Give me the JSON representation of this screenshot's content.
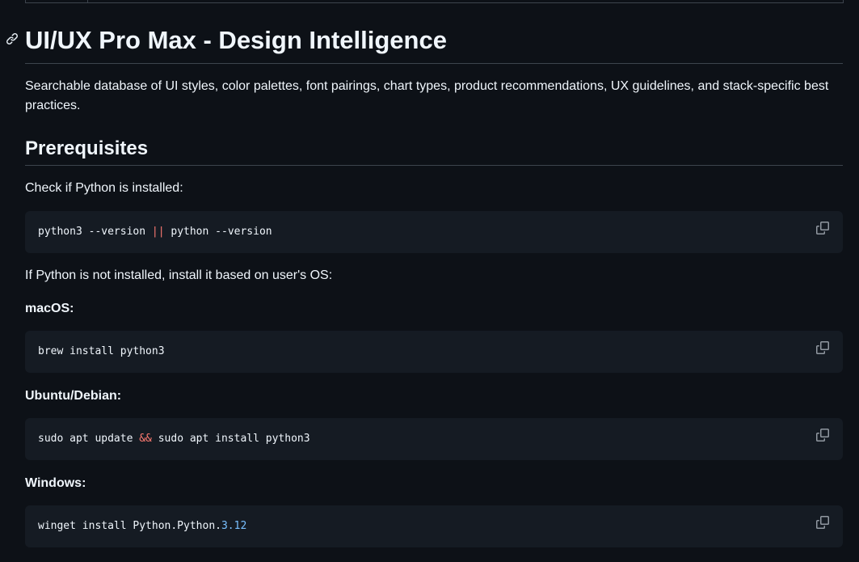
{
  "heading": {
    "title": "UI/UX Pro Max - Design Intelligence",
    "description": "Searchable database of UI styles, color palettes, font pairings, chart types, product recommendations, UX guidelines, and stack-specific best practices."
  },
  "prerequisites": {
    "title": "Prerequisites",
    "check_text": "Check if Python is installed:",
    "check_code": {
      "part1": "python3 --version ",
      "op": "||",
      "part2": " python --version"
    },
    "install_text": "If Python is not installed, install it based on user's OS:"
  },
  "platforms": {
    "macos": {
      "label": "macOS:",
      "code": "brew install python3"
    },
    "ubuntu": {
      "label": "Ubuntu/Debian:",
      "code_part1": "sudo apt update ",
      "op": "&&",
      "code_part2": " sudo apt install python3"
    },
    "windows": {
      "label": "Windows:",
      "code_part1": "winget install Python.Python.",
      "version": "3.12"
    }
  },
  "icons": {
    "anchor": "link-icon",
    "copy": "copy-icon"
  },
  "colors": {
    "background": "#0d1117",
    "code_background": "#151b23",
    "text": "#f0f6fc",
    "operator": "#ff7b72",
    "number": "#79c0ff",
    "border": "#3d444d",
    "icon": "#9198a1"
  }
}
